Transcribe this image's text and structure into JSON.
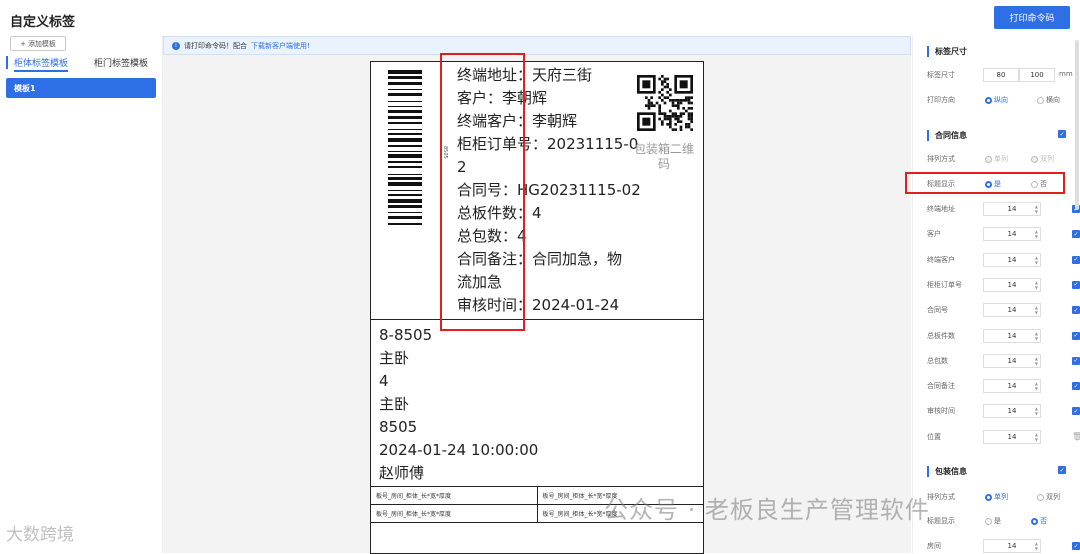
{
  "header": {
    "title": "自定义标签",
    "print_button": "打印命令码"
  },
  "sidebar": {
    "add_button": "添加模板",
    "tabs": [
      {
        "label": "柜体标签模板"
      },
      {
        "label": "柜门标签模板"
      }
    ],
    "templates": [
      {
        "label": "模板1"
      }
    ]
  },
  "notice": {
    "text": "请打印命令码！配合",
    "link": "下载新客户端使用!"
  },
  "label_preview": {
    "fields": [
      "终端地址：天府三街",
      "客户：李朝辉",
      "终端客户：李朝辉",
      "柜柜订单号：20231115-0",
      "2",
      "合同号：HG20231115-02",
      "总板件数：4",
      "总包数：4",
      "合同备注：合同加急，物",
      "流加急",
      "审核时间：2024-01-24"
    ],
    "qr_label_1": "包装箱二维",
    "qr_label_2": "码",
    "barcode_text": "8505",
    "lower_lines": [
      "8-8505",
      "主卧",
      "4",
      "主卧",
      "8505",
      "2024-01-24 10:00:00",
      "赵师傅"
    ],
    "table": [
      [
        "板号_房间_柜体_长*宽*厚度",
        "板号_房间_柜体_长*宽*厚度"
      ],
      [
        "板号_房间_柜体_长*宽*厚度",
        "板号_房间_柜体_长*宽*厚度"
      ]
    ]
  },
  "settings": {
    "size": {
      "title": "标签尺寸",
      "size_label": "标签尺寸",
      "width": "80",
      "height": "100",
      "unit": "mm",
      "direction_label": "打印方向",
      "dir_opt1": "纵向",
      "dir_opt2": "横向"
    },
    "contract": {
      "title": "合同信息",
      "arrange_label": "排列方式",
      "arrange_opt1": "单列",
      "arrange_opt2": "双列",
      "title_show_label": "标题显示",
      "title_opt1": "是",
      "title_opt2": "否",
      "fields": [
        {
          "label": "终端地址",
          "value": "14"
        },
        {
          "label": "客户",
          "value": "14"
        },
        {
          "label": "终端客户",
          "value": "14"
        },
        {
          "label": "柜柜订单号",
          "value": "14"
        },
        {
          "label": "合同号",
          "value": "14"
        },
        {
          "label": "总板件数",
          "value": "14"
        },
        {
          "label": "总包数",
          "value": "14"
        },
        {
          "label": "合同备注",
          "value": "14"
        },
        {
          "label": "审核时间",
          "value": "14"
        },
        {
          "label": "位置",
          "value": "14"
        }
      ]
    },
    "package": {
      "title": "包装信息",
      "arrange_label": "排列方式",
      "arrange_opt1": "单列",
      "arrange_opt2": "双列",
      "title_show_label": "标题显示",
      "title_opt1": "是",
      "title_opt2": "否",
      "room_label": "房间",
      "room_value": "14"
    }
  },
  "watermark": {
    "text1": "公众号 · 老板良生产管理软件",
    "text2": "大数跨境"
  }
}
